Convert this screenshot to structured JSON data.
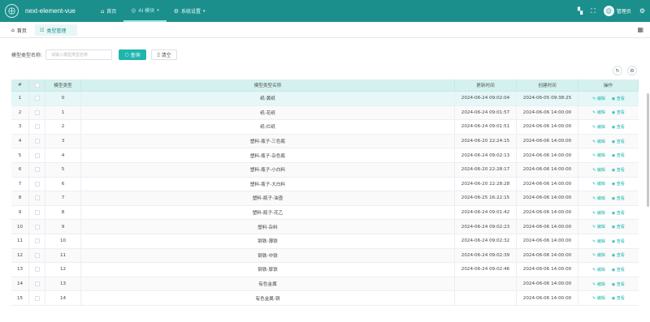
{
  "app": {
    "title": "next-element-vue"
  },
  "topnav": [
    {
      "icon": "home-icon",
      "label": "首页"
    },
    {
      "icon": "ai-icon",
      "label": "AI 模块"
    },
    {
      "icon": "settings-icon",
      "label": "系统设置"
    }
  ],
  "header": {
    "username": "管理员"
  },
  "tags": {
    "home": "首页",
    "active": "类型管理"
  },
  "search": {
    "label": "模型类型名称:",
    "placeholder": "请输入模型类型名称",
    "query_label": "查询",
    "reset_label": "清空"
  },
  "table": {
    "columns": [
      "#",
      "",
      "模型类型",
      "模型类型名称",
      "更新时间",
      "创建时间",
      "操作"
    ],
    "edit_label": "编辑",
    "view_label": "查看",
    "rows": [
      {
        "idx": "1",
        "type": "0",
        "name": "纸-黄纸",
        "updated": "2024-06-24 09:02:04",
        "created": "2024-06-05 09:38:25"
      },
      {
        "idx": "2",
        "type": "1",
        "name": "纸-花纸",
        "updated": "2024-06-24 09:01:57",
        "created": "2024-06-06 14:00:00"
      },
      {
        "idx": "3",
        "type": "2",
        "name": "纸-烂纸",
        "updated": "2024-06-24 09:01:51",
        "created": "2024-06-06 14:00:00"
      },
      {
        "idx": "4",
        "type": "3",
        "name": "塑料-瓶子-三色瓶",
        "updated": "2024-06-20 22:24:15",
        "created": "2024-06-06 14:00:00"
      },
      {
        "idx": "5",
        "type": "4",
        "name": "塑料-瓶子-杂色瓶",
        "updated": "2024-06-24 09:02:13",
        "created": "2024-06-06 14:00:00"
      },
      {
        "idx": "6",
        "type": "5",
        "name": "塑料-瓶子-小白料",
        "updated": "2024-06-20 22:28:17",
        "created": "2024-06-06 14:00:00"
      },
      {
        "idx": "7",
        "type": "6",
        "name": "塑料-瓶子-大白料",
        "updated": "2024-06-20 22:28:28",
        "created": "2024-06-06 14:00:00"
      },
      {
        "idx": "8",
        "type": "7",
        "name": "塑料-瓶子-油壶",
        "updated": "2024-06-25 16:22:15",
        "created": "2024-06-06 14:00:00"
      },
      {
        "idx": "9",
        "type": "8",
        "name": "塑料-瓶子-花乙",
        "updated": "2024-06-24 09:01:42",
        "created": "2024-06-06 14:00:00"
      },
      {
        "idx": "10",
        "type": "9",
        "name": "塑料-杂料",
        "updated": "2024-06-24 09:02:23",
        "created": "2024-06-06 14:00:00"
      },
      {
        "idx": "11",
        "type": "10",
        "name": "钢铁-薄铁",
        "updated": "2024-06-24 09:02:32",
        "created": "2024-06-06 14:00:00"
      },
      {
        "idx": "12",
        "type": "11",
        "name": "钢铁-中铁",
        "updated": "2024-06-24 09:02:39",
        "created": "2024-06-06 14:00:00"
      },
      {
        "idx": "13",
        "type": "12",
        "name": "钢铁-厚铁",
        "updated": "2024-06-24 09:02:46",
        "created": "2024-06-06 14:00:00"
      },
      {
        "idx": "14",
        "type": "13",
        "name": "有色金属",
        "updated": "",
        "created": "2024-06-06 14:00:00"
      },
      {
        "idx": "15",
        "type": "14",
        "name": "有色金属-铜",
        "updated": "",
        "created": "2024-06-06 14:00:00"
      }
    ]
  },
  "colors": {
    "header_bg": "#1b8f8c",
    "accent": "#1fb5ad",
    "table_head_bg": "#d4f0ef",
    "hover_row_bg": "#e5f7f6"
  }
}
